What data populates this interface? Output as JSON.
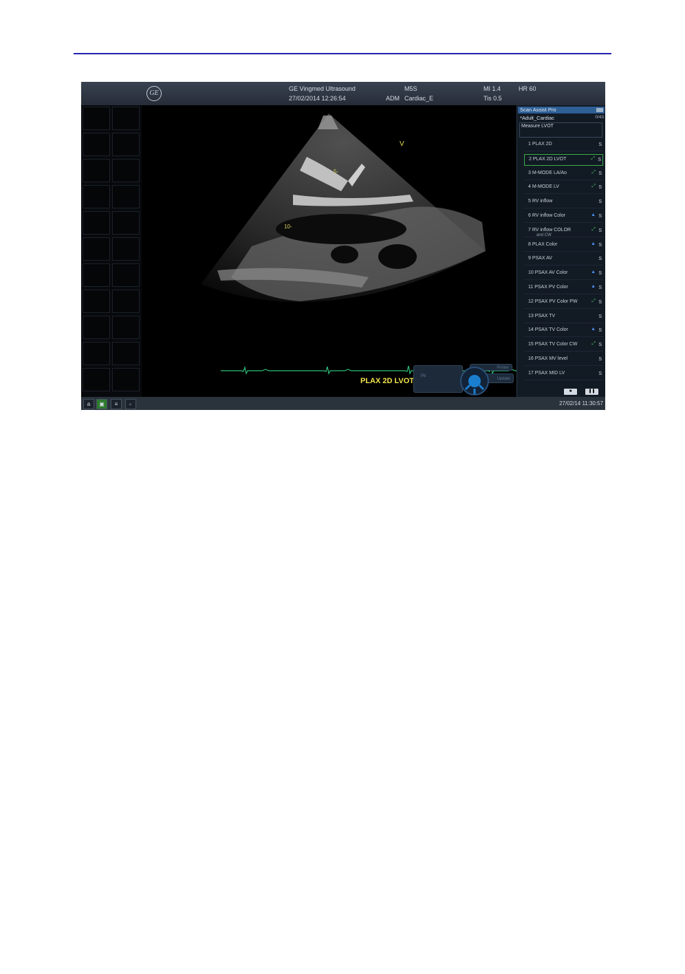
{
  "header": {
    "logo": "GE",
    "device": "GE Vingmed Ultrasound",
    "datetime": "27/02/2014 12:26:54",
    "probe": "M5S",
    "operator": "ADM",
    "preset": "Cardiac_E",
    "mi": "MI 1.4",
    "tis": "Tis 0.5",
    "hr": "HR 60"
  },
  "image": {
    "v_marker": "V",
    "depth_5": "5-",
    "depth_10": "10-",
    "view_label": "PLAX 2D LVOT",
    "hr_value": "60",
    "hr_unit": "HR"
  },
  "controls": {
    "pad_left": "Pb",
    "pad_top": "Printer",
    "pad_right": "Update"
  },
  "scan_assist": {
    "title": "Scan Assist Pro",
    "protocol": "*Adult_Cardiac",
    "count": "0/43",
    "current_step": "Measure LVOT",
    "steps": [
      {
        "label": "1  PLAX 2D",
        "sub": "",
        "icon": "",
        "s": "S"
      },
      {
        "label": "2  PLAX 2D LVOT",
        "sub": "",
        "icon": "measure-icon",
        "s": "S"
      },
      {
        "label": "3  M-MODE LA/Ao",
        "sub": "",
        "icon": "measure-icon",
        "s": "S"
      },
      {
        "label": "4  M-MODE LV",
        "sub": "",
        "icon": "measure-icon",
        "s": "S"
      },
      {
        "label": "5  RV inflow",
        "sub": "",
        "icon": "",
        "s": "S"
      },
      {
        "label": "6  RV inflow Color",
        "sub": "",
        "icon": "color-icon",
        "s": "S"
      },
      {
        "label": "7  RV inflow COLOR",
        "sub": "and CW",
        "icon": "measure-icon",
        "s": "S"
      },
      {
        "label": "8  PLAX Color",
        "sub": "",
        "icon": "color-icon",
        "s": "S"
      },
      {
        "label": "9  PSAX AV",
        "sub": "",
        "icon": "",
        "s": "S"
      },
      {
        "label": "10 PSAX AV Color",
        "sub": "",
        "icon": "color-icon",
        "s": "S"
      },
      {
        "label": "11 PSAX PV  Color",
        "sub": "",
        "icon": "color-icon",
        "s": "S"
      },
      {
        "label": "12 PSAX PV  Color PW",
        "sub": "",
        "icon": "measure-icon",
        "s": "S"
      },
      {
        "label": "13 PSAX TV",
        "sub": "",
        "icon": "",
        "s": "S"
      },
      {
        "label": "14 PSAX TV Color",
        "sub": "",
        "icon": "color-icon",
        "s": "S"
      },
      {
        "label": "15 PSAX TV  Color  CW",
        "sub": "",
        "icon": "measure-icon",
        "s": "S"
      },
      {
        "label": "16 PSAX MV level",
        "sub": "",
        "icon": "",
        "s": "S"
      },
      {
        "label": "17 PSAX MID  LV",
        "sub": "",
        "icon": "",
        "s": "S"
      }
    ],
    "stop_icon": "■",
    "pause_icon": "❚❚"
  },
  "statusbar": {
    "btn_a": "a",
    "btn_2": "▣",
    "btn_3": "≡",
    "btn_4": "▸",
    "datetime": "27/02/14 11:30:57"
  },
  "colors": {
    "rule": "#1f1fb0",
    "accent_yellow": "#f2e44a",
    "ecg_green": "#2fbf7a",
    "active_green": "#3cae4a"
  }
}
